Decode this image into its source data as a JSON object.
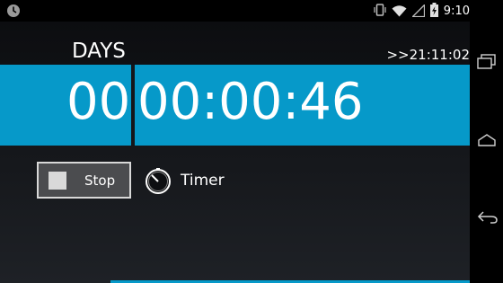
{
  "status_bar": {
    "time": "9:10",
    "left_icon": "clock-status-icon",
    "icons": [
      "vibrate-icon",
      "wifi-icon",
      "signal-icon",
      "battery-charging-icon"
    ]
  },
  "header": {
    "days_label": "DAYS",
    "current_time": ">>21:11:02"
  },
  "display": {
    "days": "00",
    "time": "00:00:46"
  },
  "controls": {
    "stop_label": "Stop",
    "mode_label": "Timer"
  },
  "nav": {
    "buttons": [
      "recent-apps-icon",
      "home-icon",
      "back-icon"
    ]
  },
  "colors": {
    "accent": "#0699c9",
    "background": "#16181c"
  }
}
